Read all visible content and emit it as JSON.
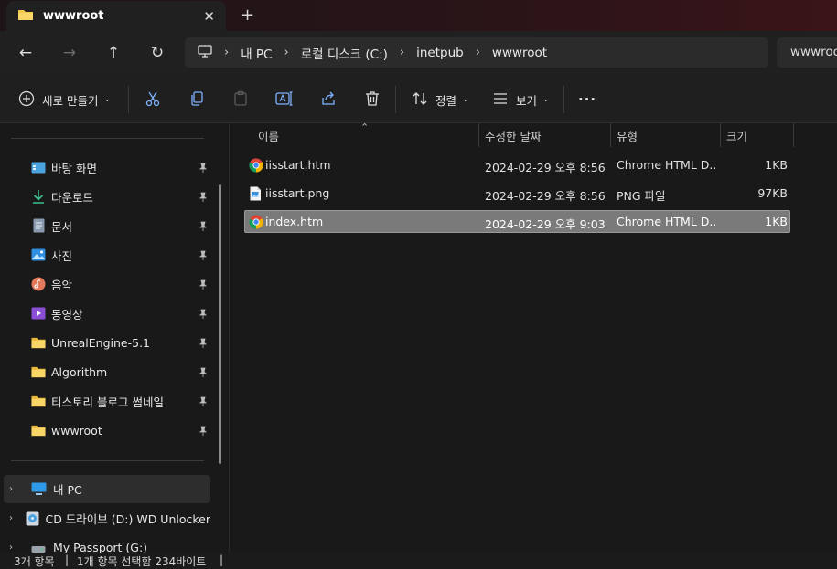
{
  "window": {
    "tab_title": "wwwroot",
    "close_glyph": "✕",
    "new_tab_glyph": "+"
  },
  "nav": {
    "back_glyph": "←",
    "forward_glyph": "→",
    "up_glyph": "↑",
    "refresh_glyph": "↻",
    "breadcrumbs": [
      "내 PC",
      "로컬 디스크 (C:)",
      "inetpub",
      "wwwroot"
    ],
    "separator": "›",
    "search_placeholder": "wwwroot"
  },
  "toolbar": {
    "new_label": "새로 만들기",
    "sort_label": "정렬",
    "view_label": "보기",
    "more_glyph": "···",
    "chevron": "⌄",
    "icons": [
      "cut-icon",
      "copy-icon",
      "paste-icon",
      "rename-icon",
      "share-icon",
      "delete-icon"
    ]
  },
  "sidebar": {
    "quick_access": [
      {
        "label": "바탕 화면",
        "icon": "desktop-icon"
      },
      {
        "label": "다운로드",
        "icon": "download-icon"
      },
      {
        "label": "문서",
        "icon": "documents-icon"
      },
      {
        "label": "사진",
        "icon": "pictures-icon"
      },
      {
        "label": "음악",
        "icon": "music-icon"
      },
      {
        "label": "동영상",
        "icon": "videos-icon"
      },
      {
        "label": "UnrealEngine-5.1",
        "icon": "folder-icon"
      },
      {
        "label": "Algorithm",
        "icon": "folder-icon"
      },
      {
        "label": "티스토리 블로그 썸네일",
        "icon": "folder-icon"
      },
      {
        "label": "wwwroot",
        "icon": "folder-icon"
      }
    ],
    "tree": [
      {
        "label": "내 PC",
        "icon": "pc-icon"
      },
      {
        "label": "CD 드라이브 (D:) WD Unlocker",
        "icon": "cd-drive-icon"
      },
      {
        "label": "My Passport (G:)",
        "icon": "drive-icon"
      }
    ],
    "expand_glyph": "›"
  },
  "files": {
    "columns": [
      "이름",
      "수정한 날짜",
      "유형",
      "크기"
    ],
    "sort_glyph": "⌃",
    "rows": [
      {
        "name": "iisstart.htm",
        "date": "2024-02-29 오후 8:56",
        "type": "Chrome HTML D...",
        "size": "1KB",
        "icon": "chrome-icon"
      },
      {
        "name": "iisstart.png",
        "date": "2024-02-29 오후 8:56",
        "type": "PNG 파일",
        "size": "97KB",
        "icon": "png-file-icon"
      },
      {
        "name": "index.htm",
        "date": "2024-02-29 오후 9:03",
        "type": "Chrome HTML D...",
        "size": "1KB",
        "icon": "chrome-icon"
      }
    ]
  },
  "status": {
    "item_count": "3개 항목",
    "selection": "1개 항목 선택함 234바이트",
    "divider": "|"
  },
  "colors": {
    "folder": "#f2c94c",
    "accent_selection": "#7a7a7a"
  }
}
